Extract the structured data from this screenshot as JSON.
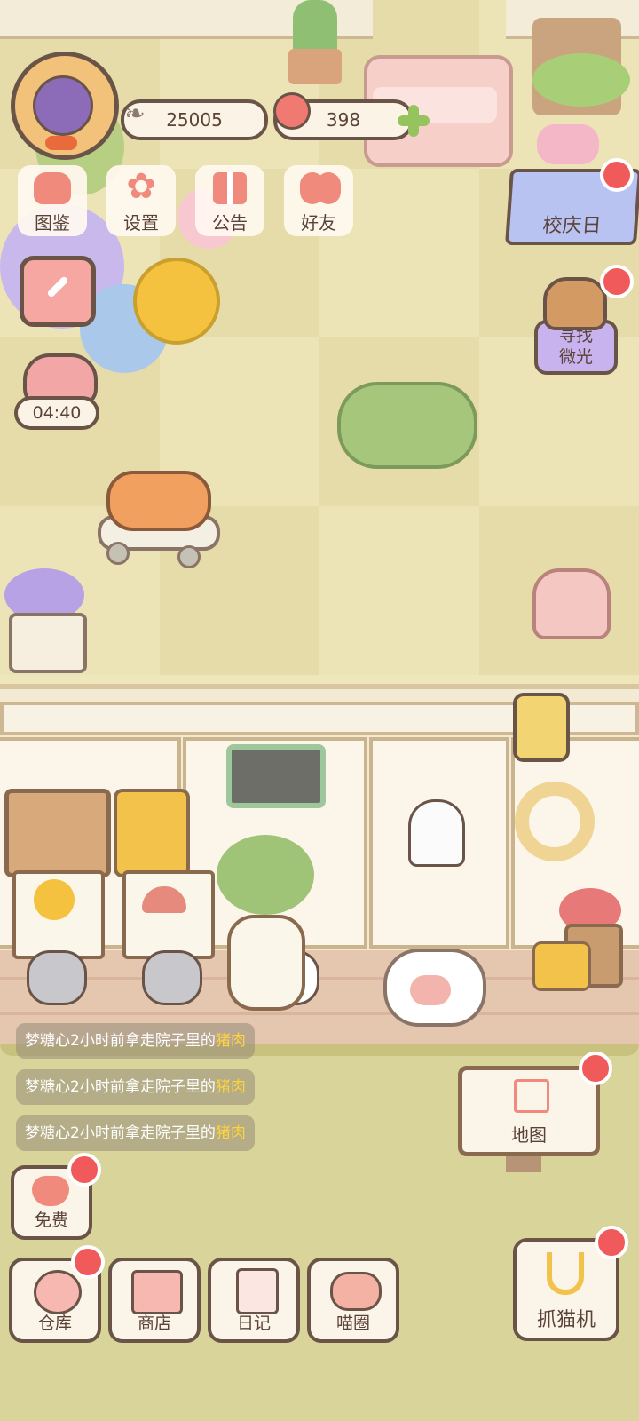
{
  "currency": {
    "fish_coins": "25005",
    "hearts": "398"
  },
  "top_menu": {
    "items": [
      "图鉴",
      "设置",
      "公告",
      "好友"
    ]
  },
  "timer": "04:40",
  "events": {
    "anniversary": "校庆日",
    "find_light": [
      "寻找",
      "微光"
    ]
  },
  "activity_log": {
    "messages": [
      {
        "prefix": "梦糖心2小时前拿走院子里的",
        "item": "猪肉"
      },
      {
        "prefix": "梦糖心2小时前拿走院子里的",
        "item": "猪肉"
      },
      {
        "prefix": "梦糖心2小时前拿走院子里的",
        "item": "猪肉"
      }
    ]
  },
  "map_button": "地图",
  "free_button": "免费",
  "bottom_nav": {
    "items": [
      "仓库",
      "商店",
      "日记",
      "喵圈"
    ]
  },
  "claw_machine": "抓猫机",
  "colors": {
    "accent_red": "#f05a5a",
    "brown_outline": "#6a5448",
    "highlight_yellow": "#ffd43b",
    "pink_icon": "#f08a7c"
  }
}
